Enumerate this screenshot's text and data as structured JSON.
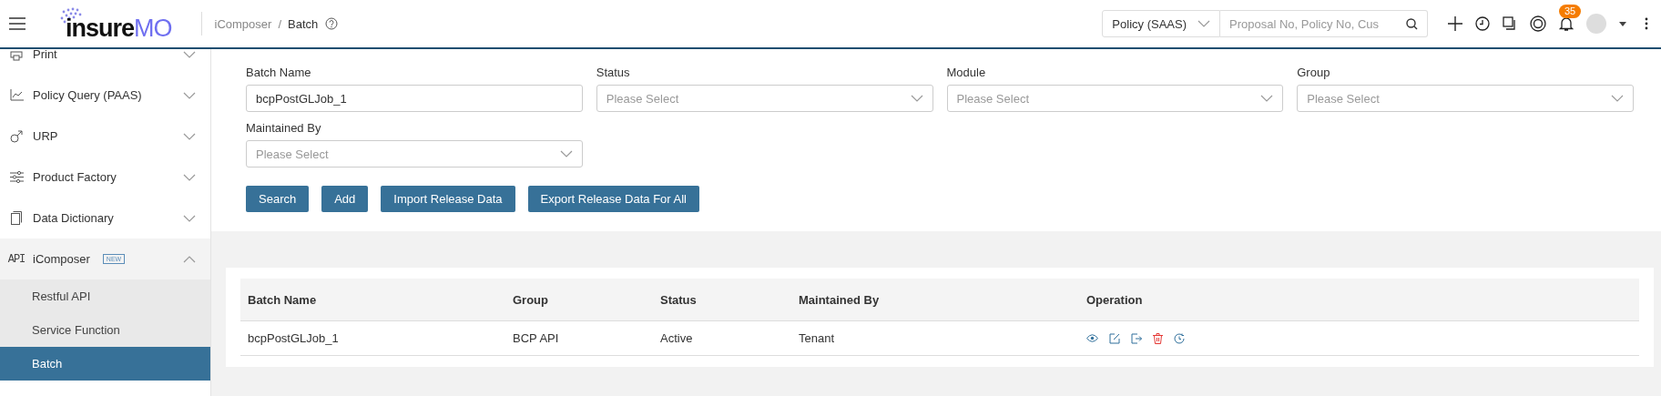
{
  "header": {
    "logo": {
      "part_1": "insure",
      "part_2": "MO"
    },
    "breadcrumb": [
      {
        "label": "iComposer",
        "current": false
      },
      {
        "label": "Batch",
        "current": true
      }
    ],
    "breadcrumb_separator": "/",
    "search": {
      "scope": "Policy (SAAS)",
      "placeholder": "Proposal No, Policy No, Cus"
    },
    "notifications": {
      "badge": "35"
    }
  },
  "sidebar": {
    "items": [
      {
        "label": "Print",
        "expanded": false
      },
      {
        "label": "Policy Query (PAAS)",
        "expanded": false
      },
      {
        "label": "URP",
        "expanded": false
      },
      {
        "label": "Product Factory",
        "expanded": false
      },
      {
        "label": "Data Dictionary",
        "expanded": false
      },
      {
        "label": "iComposer",
        "icon_text": "API",
        "badge": "NEW",
        "expanded": true,
        "children": [
          {
            "label": "Restful API",
            "selected": false
          },
          {
            "label": "Service Function",
            "selected": false
          },
          {
            "label": "Batch",
            "selected": true
          }
        ]
      }
    ]
  },
  "form": {
    "fields": [
      {
        "label": "Batch Name",
        "kind": "text",
        "value": "bcpPostGLJob_1"
      },
      {
        "label": "Status",
        "kind": "select",
        "placeholder": "Please Select"
      },
      {
        "label": "Module",
        "kind": "select",
        "placeholder": "Please Select"
      },
      {
        "label": "Group",
        "kind": "select",
        "placeholder": "Please Select"
      },
      {
        "label": "Maintained By",
        "kind": "select",
        "placeholder": "Please Select"
      }
    ],
    "buttons": [
      "Search",
      "Add",
      "Import Release Data",
      "Export Release Data For All"
    ]
  },
  "table": {
    "columns": [
      "Batch Name",
      "Group",
      "Status",
      "Maintained By",
      "Operation"
    ],
    "rows": [
      {
        "cells": [
          "bcpPostGLJob_1",
          "BCP API",
          "Active",
          "Tenant"
        ]
      }
    ]
  }
}
